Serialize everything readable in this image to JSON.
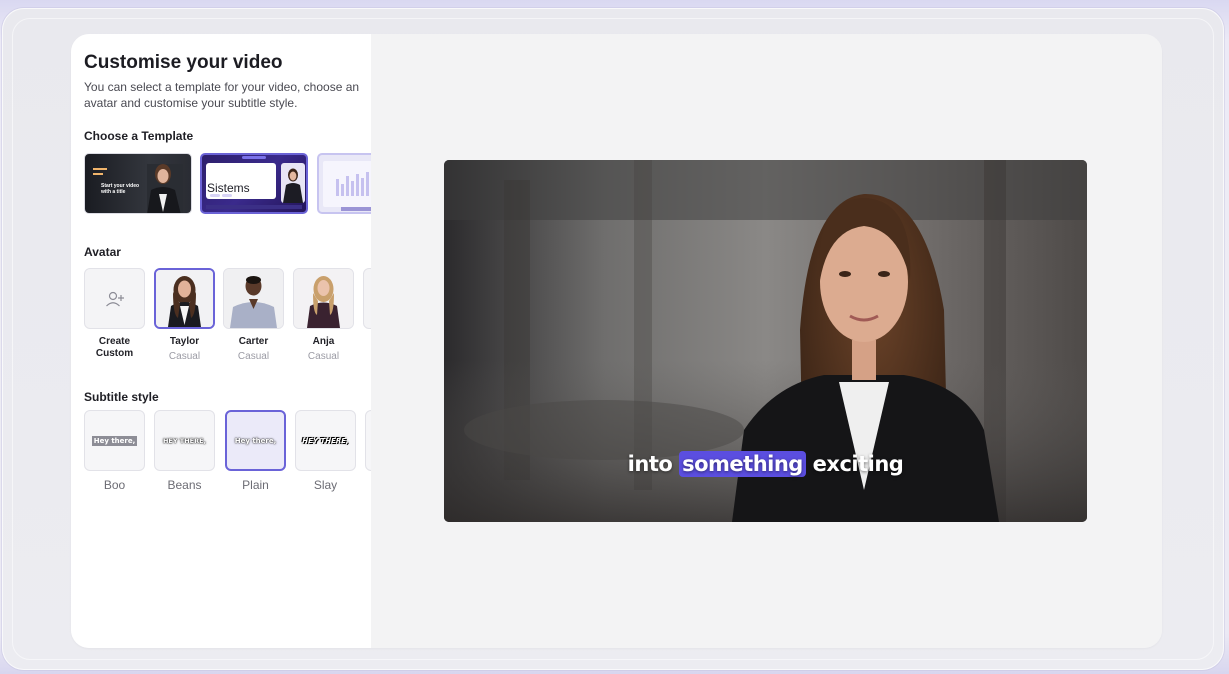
{
  "header": {
    "title": "Customise your video",
    "description": "You can select a template for your video, choose an avatar and customise your subtitle style."
  },
  "sections": {
    "template": "Choose a Template",
    "avatar": "Avatar",
    "subtitle": "Subtitle style"
  },
  "templates": [
    {
      "name": "dark-talking-head",
      "text": "Start your video with a title",
      "top_text": "",
      "selected": false
    },
    {
      "name": "purple-slide",
      "text": "Sistems",
      "top_text": "",
      "selected": true
    },
    {
      "name": "chart-slide",
      "text": "",
      "top_text": "",
      "selected": false
    }
  ],
  "avatars": {
    "create": {
      "name": "Create Custom",
      "icon": "add-user-icon"
    },
    "items": [
      {
        "name": "Taylor",
        "style": "Casual",
        "selected": true
      },
      {
        "name": "Carter",
        "style": "Casual",
        "selected": false
      },
      {
        "name": "Anja",
        "style": "Casual",
        "selected": false
      }
    ]
  },
  "subtitle_styles": [
    {
      "label": "Boo",
      "sample": "Hey there,",
      "selected": false
    },
    {
      "label": "Beans",
      "sample": "HEY THERE,",
      "selected": false
    },
    {
      "label": "Plain",
      "sample": "Hey there,",
      "selected": true
    },
    {
      "label": "Slay",
      "sample": "HEY THERE,",
      "selected": false
    }
  ],
  "preview": {
    "caption_before": "into",
    "caption_highlight": "something",
    "caption_after": "exciting"
  },
  "colors": {
    "accent": "#6a63d8",
    "highlight": "#5b4ee0"
  }
}
